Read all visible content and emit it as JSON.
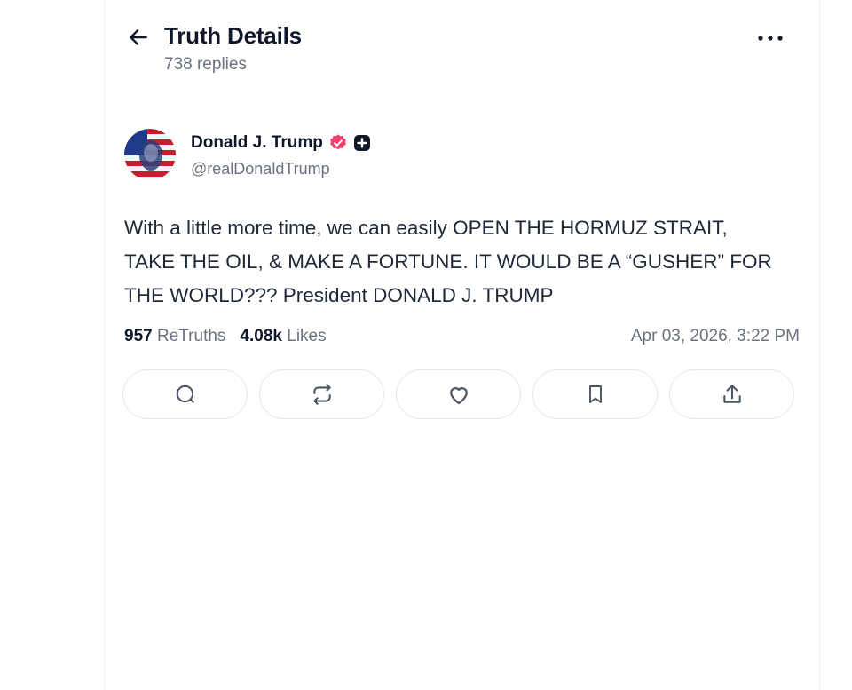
{
  "header": {
    "title": "Truth Details",
    "subtitle": "738 replies",
    "back_icon": "arrow-left-icon",
    "more_icon": "more-horizontal-icon"
  },
  "post": {
    "author": {
      "name": "Donald J. Trump",
      "handle": "@realDonaldTrump",
      "verified_icon": "verified-badge-icon",
      "plus_icon": "plus-badge-icon",
      "verified_color": "#f43f6d"
    },
    "text": "With a little more time, we can easily OPEN THE HORMUZ STRAIT, TAKE THE OIL, & MAKE A FORTUNE. IT WOULD BE A “GUSHER” FOR THE WORLD??? President DONALD J. TRUMP",
    "stats": {
      "retruths_count": "957",
      "retruths_label": "ReTruths",
      "likes_count": "4.08k",
      "likes_label": "Likes",
      "date": "Apr 03, 2026, 3:22 PM"
    },
    "actions": [
      {
        "name": "reply",
        "icon": "comment-icon"
      },
      {
        "name": "retruth",
        "icon": "repost-icon"
      },
      {
        "name": "like",
        "icon": "heart-icon"
      },
      {
        "name": "bookmark",
        "icon": "bookmark-icon"
      },
      {
        "name": "share",
        "icon": "share-icon"
      }
    ]
  }
}
